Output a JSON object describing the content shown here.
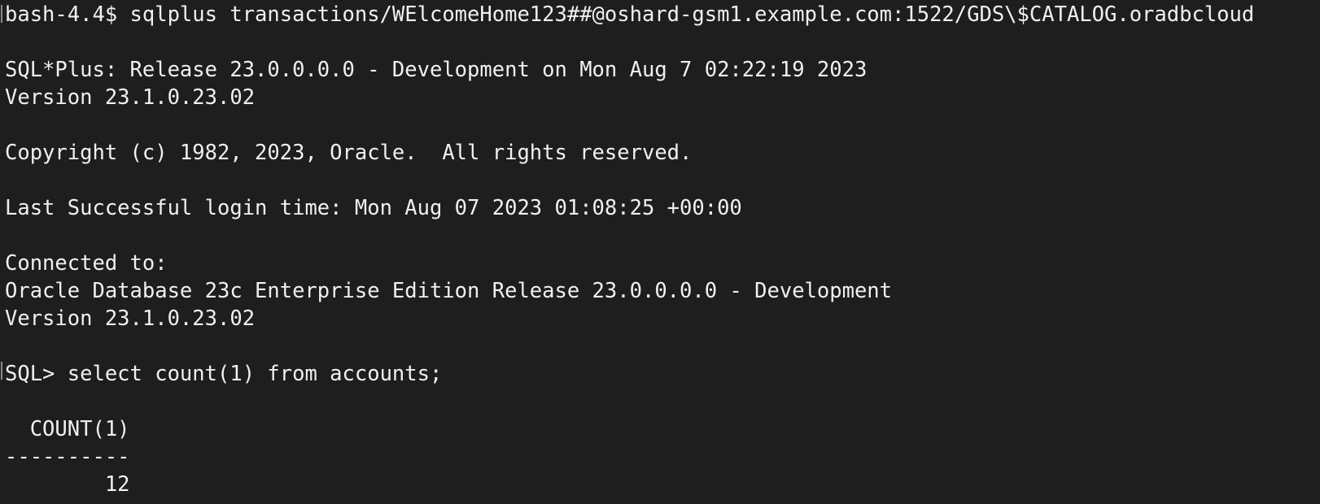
{
  "terminal": {
    "background": "#1e1e1e",
    "foreground": "#f0f0f0",
    "lines": [
      "bash-4.4$ sqlplus transactions/WElcomeHome123##@oshard-gsm1.example.com:1522/GDS\\$CATALOG.oradbcloud",
      "",
      "SQL*Plus: Release 23.0.0.0.0 - Development on Mon Aug 7 02:22:19 2023",
      "Version 23.1.0.23.02",
      "",
      "Copyright (c) 1982, 2023, Oracle.  All rights reserved.",
      "",
      "Last Successful login time: Mon Aug 07 2023 01:08:25 +00:00",
      "",
      "Connected to:",
      "Oracle Database 23c Enterprise Edition Release 23.0.0.0.0 - Development",
      "Version 23.1.0.23.02",
      "",
      "SQL> select count(1) from accounts;",
      "",
      "  COUNT(1)",
      "----------",
      "        12"
    ]
  }
}
